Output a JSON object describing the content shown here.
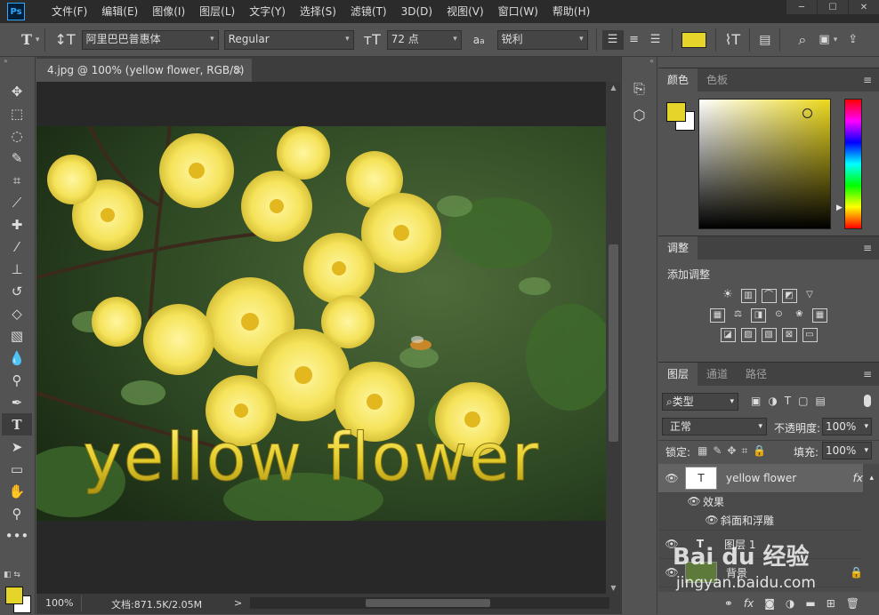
{
  "menubar": {
    "logo": "Ps",
    "items": [
      "文件(F)",
      "编辑(E)",
      "图像(I)",
      "图层(L)",
      "文字(Y)",
      "选择(S)",
      "滤镜(T)",
      "3D(D)",
      "视图(V)",
      "窗口(W)",
      "帮助(H)"
    ]
  },
  "options": {
    "font_family": "阿里巴巴普惠体",
    "font_style": "Regular",
    "font_size": "72 点",
    "aa_label": "a",
    "antialias": "锐利",
    "text_color": "#e5d52a"
  },
  "document": {
    "tab_title": "4.jpg @ 100% (yellow flower, RGB/8) *",
    "close": "×",
    "text_on_canvas": "yellow flower",
    "zoom": "100%",
    "doc_size": "文档:871.5K/2.05M",
    "arrow": ">"
  },
  "color_panel": {
    "tabs": [
      "颜色",
      "色板"
    ],
    "foreground": "#e5d52a",
    "background": "#ffffff"
  },
  "adjust_panel": {
    "tab": "调整",
    "title": "添加调整"
  },
  "layers_panel": {
    "tabs": [
      "图层",
      "通道",
      "路径"
    ],
    "filter": "类型",
    "blend": "正常",
    "opacity_label": "不透明度:",
    "opacity": "100%",
    "lock_label": "锁定:",
    "fill_label": "填充:",
    "fill": "100%",
    "layers": [
      {
        "name": "yellow flower",
        "fx": "fx"
      },
      {
        "name": "效果"
      },
      {
        "name": "斜面和浮雕"
      },
      {
        "name": "图层 1"
      },
      {
        "name": "背景"
      }
    ]
  },
  "watermark": {
    "brand": "Bai du 经验",
    "url": "jingyan.baidu.com"
  }
}
